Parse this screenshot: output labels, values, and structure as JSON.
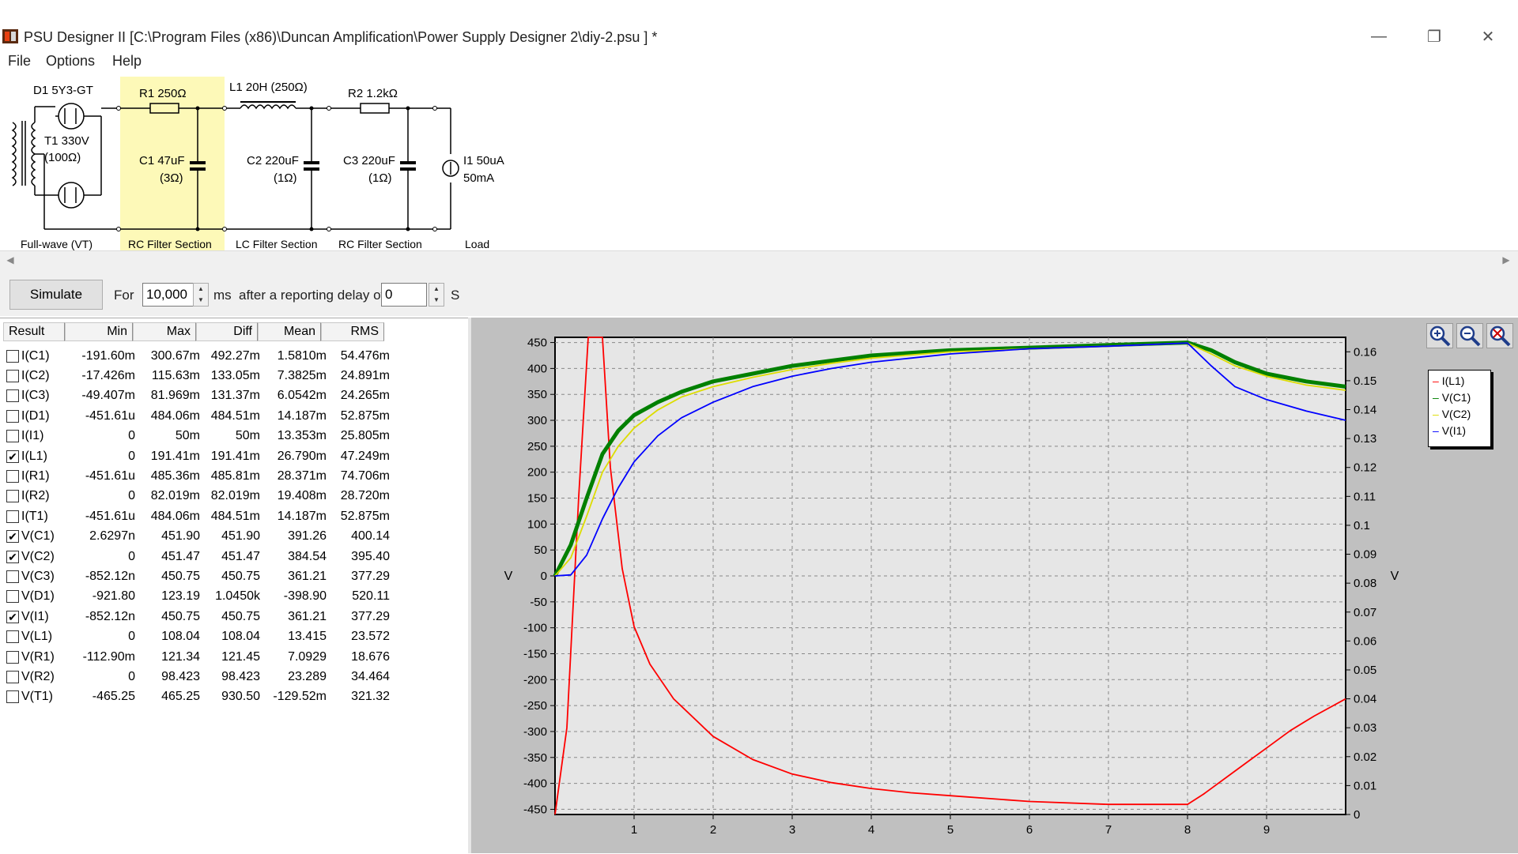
{
  "window": {
    "title": "PSU Designer II  [C:\\Program Files (x86)\\Duncan Amplification\\Power Supply Designer 2\\diy-2.psu ] *",
    "minimize_glyph": "—",
    "maximize_glyph": "❐",
    "close_glyph": "✕"
  },
  "menu": [
    "File",
    "Options",
    "Help"
  ],
  "schematic": {
    "d1": "D1 5Y3-GT",
    "t1_line1": "T1 330V",
    "t1_line2": "(100Ω)",
    "r1": "R1 250Ω",
    "c1_line1": "C1 47uF",
    "c1_line2": "(3Ω)",
    "l1": "L1 20H (250Ω)",
    "c2_line1": "C2 220uF",
    "c2_line2": "(1Ω)",
    "r2": "R2 1.2kΩ",
    "c3_line1": "C3 220uF",
    "c3_line2": "(1Ω)",
    "i1_line1": "I1 50uA",
    "i1_line2": "50mA",
    "sections": [
      "Full-wave (VT)",
      "RC Filter Section",
      "LC Filter Section",
      "RC Filter Section",
      "Load"
    ]
  },
  "controls": {
    "simulate": "Simulate",
    "for_label": "For",
    "duration": "10,000",
    "ms_label": "ms",
    "delay_label": "after a reporting delay of",
    "delay": "0",
    "s_label": "S"
  },
  "results": {
    "columns": [
      "Result",
      "Min",
      "Max",
      "Diff",
      "Mean",
      "RMS"
    ],
    "rows": [
      {
        "checked": false,
        "name": "I(C1)",
        "min": "-191.60m",
        "max": "300.67m",
        "diff": "492.27m",
        "mean": "1.5810m",
        "rms": "54.476m"
      },
      {
        "checked": false,
        "name": "I(C2)",
        "min": "-17.426m",
        "max": "115.63m",
        "diff": "133.05m",
        "mean": "7.3825m",
        "rms": "24.891m"
      },
      {
        "checked": false,
        "name": "I(C3)",
        "min": "-49.407m",
        "max": "81.969m",
        "diff": "131.37m",
        "mean": "6.0542m",
        "rms": "24.265m"
      },
      {
        "checked": false,
        "name": "I(D1)",
        "min": "-451.61u",
        "max": "484.06m",
        "diff": "484.51m",
        "mean": "14.187m",
        "rms": "52.875m"
      },
      {
        "checked": false,
        "name": "I(I1)",
        "min": "0",
        "max": "50m",
        "diff": "50m",
        "mean": "13.353m",
        "rms": "25.805m"
      },
      {
        "checked": true,
        "name": "I(L1)",
        "min": "0",
        "max": "191.41m",
        "diff": "191.41m",
        "mean": "26.790m",
        "rms": "47.249m"
      },
      {
        "checked": false,
        "name": "I(R1)",
        "min": "-451.61u",
        "max": "485.36m",
        "diff": "485.81m",
        "mean": "28.371m",
        "rms": "74.706m"
      },
      {
        "checked": false,
        "name": "I(R2)",
        "min": "0",
        "max": "82.019m",
        "diff": "82.019m",
        "mean": "19.408m",
        "rms": "28.720m"
      },
      {
        "checked": false,
        "name": "I(T1)",
        "min": "-451.61u",
        "max": "484.06m",
        "diff": "484.51m",
        "mean": "14.187m",
        "rms": "52.875m"
      },
      {
        "checked": true,
        "name": "V(C1)",
        "min": "2.6297n",
        "max": "451.90",
        "diff": "451.90",
        "mean": "391.26",
        "rms": "400.14"
      },
      {
        "checked": true,
        "name": "V(C2)",
        "min": "0",
        "max": "451.47",
        "diff": "451.47",
        "mean": "384.54",
        "rms": "395.40"
      },
      {
        "checked": false,
        "name": "V(C3)",
        "min": "-852.12n",
        "max": "450.75",
        "diff": "450.75",
        "mean": "361.21",
        "rms": "377.29"
      },
      {
        "checked": false,
        "name": "V(D1)",
        "min": "-921.80",
        "max": "123.19",
        "diff": "1.0450k",
        "mean": "-398.90",
        "rms": "520.11"
      },
      {
        "checked": true,
        "name": "V(I1)",
        "min": "-852.12n",
        "max": "450.75",
        "diff": "450.75",
        "mean": "361.21",
        "rms": "377.29"
      },
      {
        "checked": false,
        "name": "V(L1)",
        "min": "0",
        "max": "108.04",
        "diff": "108.04",
        "mean": "13.415",
        "rms": "23.572"
      },
      {
        "checked": false,
        "name": "V(R1)",
        "min": "-112.90m",
        "max": "121.34",
        "diff": "121.45",
        "mean": "7.0929",
        "rms": "18.676"
      },
      {
        "checked": false,
        "name": "V(R2)",
        "min": "0",
        "max": "98.423",
        "diff": "98.423",
        "mean": "23.289",
        "rms": "34.464"
      },
      {
        "checked": false,
        "name": "V(T1)",
        "min": "-465.25",
        "max": "465.25",
        "diff": "930.50",
        "mean": "-129.52m",
        "rms": "321.32"
      }
    ]
  },
  "chart_data": {
    "type": "line",
    "xlim": [
      0,
      10
    ],
    "x_ticks": [
      "1",
      "2",
      "3",
      "4",
      "5",
      "6",
      "7",
      "8",
      "9"
    ],
    "ylim": [
      -460,
      460
    ],
    "y_ticks": [
      "450",
      "400",
      "350",
      "300",
      "250",
      "200",
      "150",
      "100",
      "50",
      "0",
      "-50",
      "-100",
      "-150",
      "-200",
      "-250",
      "-300",
      "-350",
      "-400",
      "-450"
    ],
    "ylabel": "V",
    "y2lim": [
      0,
      0.165
    ],
    "y2_ticks": [
      "0.16",
      "0.15",
      "0.14",
      "0.13",
      "0.12",
      "0.11",
      "0.1",
      "0.09",
      "0.08",
      "0.07",
      "0.06",
      "0.05",
      "0.04",
      "0.03",
      "0.02",
      "0.01",
      "0"
    ],
    "y2label": "V",
    "grid": true,
    "legend_position": "top-right",
    "series": [
      {
        "name": "I(L1)",
        "color": "#ff0000",
        "axis": "right",
        "points": [
          [
            0,
            0
          ],
          [
            0.15,
            0.03
          ],
          [
            0.3,
            0.11
          ],
          [
            0.42,
            0.165
          ],
          [
            0.6,
            0.165
          ],
          [
            0.7,
            0.12
          ],
          [
            0.85,
            0.085
          ],
          [
            1,
            0.065
          ],
          [
            1.2,
            0.052
          ],
          [
            1.5,
            0.04
          ],
          [
            2,
            0.027
          ],
          [
            2.5,
            0.019
          ],
          [
            3,
            0.014
          ],
          [
            3.5,
            0.011
          ],
          [
            4,
            0.009
          ],
          [
            4.5,
            0.0075
          ],
          [
            5,
            0.0065
          ],
          [
            6,
            0.0045
          ],
          [
            7,
            0.0035
          ],
          [
            8,
            0.0035
          ],
          [
            8.2,
            0.007
          ],
          [
            8.5,
            0.013
          ],
          [
            8.8,
            0.019
          ],
          [
            9,
            0.023
          ],
          [
            9.3,
            0.029
          ],
          [
            9.6,
            0.034
          ],
          [
            10,
            0.04
          ]
        ]
      },
      {
        "name": "V(C1)",
        "color": "#008000",
        "axis": "left",
        "points": [
          [
            0,
            0
          ],
          [
            0.2,
            60
          ],
          [
            0.4,
            150
          ],
          [
            0.6,
            235
          ],
          [
            0.8,
            280
          ],
          [
            1,
            310
          ],
          [
            1.3,
            335
          ],
          [
            1.6,
            355
          ],
          [
            2,
            375
          ],
          [
            2.5,
            390
          ],
          [
            3,
            405
          ],
          [
            3.5,
            415
          ],
          [
            4,
            425
          ],
          [
            5,
            435
          ],
          [
            6,
            440
          ],
          [
            7,
            445
          ],
          [
            8,
            450
          ],
          [
            8.3,
            435
          ],
          [
            8.6,
            412
          ],
          [
            9,
            390
          ],
          [
            9.5,
            375
          ],
          [
            10,
            365
          ]
        ]
      },
      {
        "name": "V(C2)",
        "color": "#dddd00",
        "axis": "left",
        "points": [
          [
            0,
            0
          ],
          [
            0.2,
            35
          ],
          [
            0.4,
            115
          ],
          [
            0.6,
            200
          ],
          [
            0.8,
            250
          ],
          [
            1,
            285
          ],
          [
            1.3,
            320
          ],
          [
            1.6,
            345
          ],
          [
            2,
            365
          ],
          [
            2.5,
            383
          ],
          [
            3,
            398
          ],
          [
            3.5,
            410
          ],
          [
            4,
            420
          ],
          [
            5,
            432
          ],
          [
            6,
            438
          ],
          [
            7,
            443
          ],
          [
            8,
            449
          ],
          [
            8.3,
            428
          ],
          [
            8.6,
            405
          ],
          [
            9,
            385
          ],
          [
            9.5,
            368
          ],
          [
            10,
            358
          ]
        ]
      },
      {
        "name": "V(I1)",
        "color": "#0000ff",
        "axis": "left",
        "points": [
          [
            0,
            0
          ],
          [
            0.2,
            2
          ],
          [
            0.4,
            40
          ],
          [
            0.6,
            110
          ],
          [
            0.8,
            170
          ],
          [
            1,
            220
          ],
          [
            1.3,
            270
          ],
          [
            1.6,
            305
          ],
          [
            2,
            335
          ],
          [
            2.5,
            365
          ],
          [
            3,
            385
          ],
          [
            3.5,
            400
          ],
          [
            4,
            412
          ],
          [
            4.5,
            420
          ],
          [
            5,
            428
          ],
          [
            6,
            438
          ],
          [
            7,
            443
          ],
          [
            8,
            449
          ],
          [
            8.3,
            405
          ],
          [
            8.6,
            365
          ],
          [
            9,
            340
          ],
          [
            9.5,
            318
          ],
          [
            10,
            300
          ]
        ]
      }
    ]
  },
  "colors": {
    "plot_background": "#c0c0c0",
    "plot_area": "#e6e6e6",
    "section_highlight": "#fdf9b8"
  },
  "icons": [
    "app-icon",
    "zoom-in-icon",
    "zoom-out-icon",
    "zoom-reset-icon",
    "scroll-left-icon",
    "scroll-right-icon"
  ]
}
